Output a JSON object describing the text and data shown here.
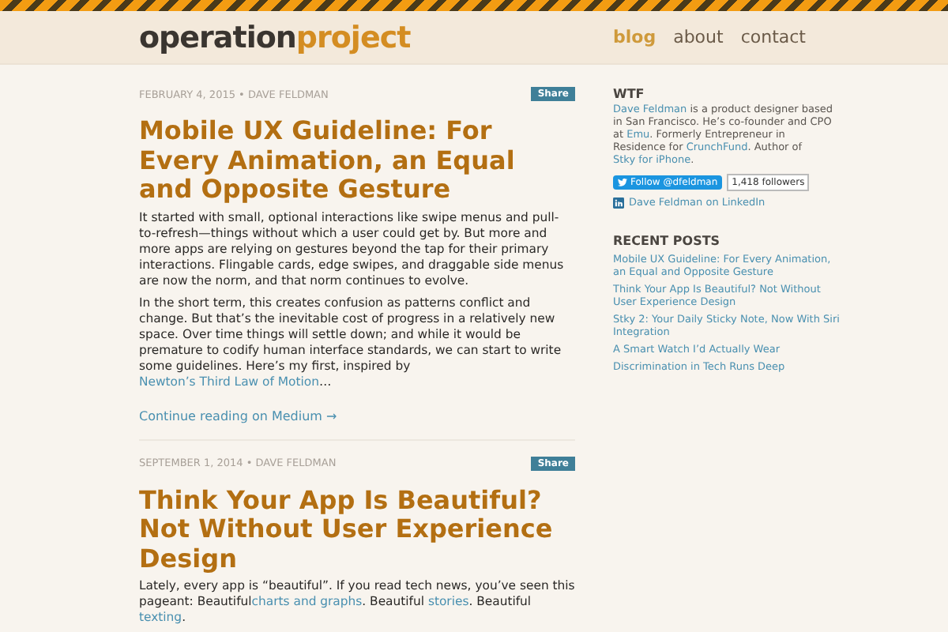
{
  "header": {
    "logo": {
      "first": "operation",
      "second": "project"
    },
    "nav": [
      {
        "label": "blog",
        "selected": true
      },
      {
        "label": "about",
        "selected": false
      },
      {
        "label": "contact",
        "selected": false
      }
    ]
  },
  "posts": [
    {
      "meta": "FEBRUARY 4, 2015 • DAVE FELDMAN",
      "share": "Share",
      "title": "Mobile UX Guideline: For Every Animation, an Equal and Opposite Gesture",
      "paragraphs": [
        [
          {
            "kind": "text",
            "text": "It started with small, optional interactions like swipe menus and pull-to-refresh—things without which a user could get by. But more and more apps are relying on gestures beyond the tap for their primary interactions. Flingable cards, edge swipes, and draggable side menus are now the norm, and that norm continues to evolve."
          }
        ],
        [
          {
            "kind": "text",
            "text": "In the short term, this creates confusion as patterns conflict and change. But that’s the inevitable cost of progress in a relatively new space. Over time things will settle down; and while it would be premature to codify human interface standards, we can start to write some guidelines. Here’s my first, inspired by "
          },
          {
            "kind": "link",
            "text": "Newton’s Third Law of Motion"
          },
          {
            "kind": "text",
            "text": "…"
          }
        ]
      ],
      "more": "Continue reading on Medium →"
    },
    {
      "meta": "SEPTEMBER 1, 2014 • DAVE FELDMAN",
      "share": "Share",
      "title": "Think Your App Is Beautiful? Not Without User Experience Design",
      "paragraphs": [
        [
          {
            "kind": "text",
            "text": "Lately, every app is “beautiful”. If you read tech news, you’ve seen this pageant: Beautiful"
          },
          {
            "kind": "link",
            "text": "charts and graphs"
          },
          {
            "kind": "text",
            "text": ". Beautiful "
          },
          {
            "kind": "link",
            "text": "stories"
          },
          {
            "kind": "text",
            "text": ". Beautiful "
          },
          {
            "kind": "link",
            "text": "texting"
          },
          {
            "kind": "text",
            "text": "."
          }
        ]
      ]
    }
  ],
  "sidebar": {
    "about": {
      "heading": "WTF",
      "bio": [
        {
          "kind": "link",
          "text": "Dave Feldman"
        },
        {
          "kind": "text",
          "text": " is a product designer based in San Francisco. He’s co-founder and CPO at "
        },
        {
          "kind": "link",
          "text": "Emu"
        },
        {
          "kind": "text",
          "text": ". Formerly Entrepreneur in Residence for "
        },
        {
          "kind": "link",
          "text": "CrunchFund"
        },
        {
          "kind": "text",
          "text": ". Author of "
        },
        {
          "kind": "link",
          "text": "Stky for iPhone"
        },
        {
          "kind": "text",
          "text": "."
        }
      ],
      "follow": "Follow @dfeldman",
      "followers": "1,418 followers",
      "linkedin": "Dave Feldman on LinkedIn"
    },
    "recent": {
      "heading": "RECENT POSTS",
      "items": [
        "Mobile UX Guideline: For Every Animation, an Equal and Opposite Gesture",
        "Think Your App Is Beautiful? Not Without User Experience Design",
        "Stky 2: Your Daily Sticky Note, Now With Siri Integration",
        "A Smart Watch I’d Actually Wear",
        "Discrimination in Tech Runs Deep"
      ]
    }
  }
}
